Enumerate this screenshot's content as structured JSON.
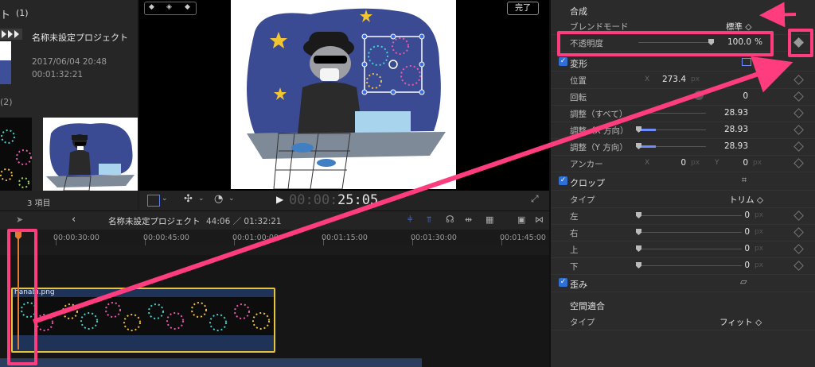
{
  "browser": {
    "section1_heading": "ト",
    "section1_count": "(1)",
    "project_name": "名称未設定プロジェクト",
    "project_date": "2017/06/04 20:48",
    "project_duration": "00:01:32:21",
    "section2_count": "(2)",
    "item_count": "3 項目"
  },
  "viewer": {
    "done_label": "完了",
    "timecode_dim": "00:00:",
    "timecode_bright": "25:05"
  },
  "timeline": {
    "project_name": "名称未設定プロジェクト",
    "position": "44:06 ／ 01:32:21",
    "ruler": [
      "00:00:30:00",
      "00:00:45:00",
      "00:01:00:00",
      "00:01:15:00",
      "00:01:30:00",
      "00:01:45:00"
    ],
    "clip_name": "hanabi.png"
  },
  "inspector": {
    "composite": {
      "title": "合成",
      "blend_label": "ブレンドモード",
      "blend_value": "標準 ◇",
      "opacity_label": "不透明度",
      "opacity_value": "100.0",
      "opacity_unit": "%"
    },
    "transform": {
      "title": "変形",
      "position_label": "位置",
      "position_x_axis": "X",
      "position_x": "273.4",
      "unit_px": "px",
      "rotation_label": "回転",
      "rotation_value": "0",
      "scale_all_label": "調整（すべて）",
      "scale_all": "28.93",
      "scale_x_label": "調整（X 方向）",
      "scale_x": "28.93",
      "scale_y_label": "調整（Y 方向）",
      "scale_y": "28.93",
      "anchor_label": "アンカー",
      "anchor_x_axis": "X",
      "anchor_x": "0",
      "anchor_y_axis": "Y",
      "anchor_y": "0"
    },
    "crop": {
      "title": "クロップ",
      "type_label": "タイプ",
      "type_value": "トリム ◇",
      "left_label": "左",
      "left_value": "0",
      "right_label": "右",
      "right_value": "0",
      "top_label": "上",
      "top_value": "0",
      "bottom_label": "下",
      "bottom_value": "0"
    },
    "distort": {
      "title": "歪み"
    },
    "spatial": {
      "title": "空間適合",
      "type_label": "タイプ",
      "type_value": "フィット ◇"
    }
  },
  "colors": {
    "accent": "#ff3c7d",
    "clip_border": "#e5c33a",
    "check": "#2f6fd6",
    "playhead": "#e07a36"
  }
}
